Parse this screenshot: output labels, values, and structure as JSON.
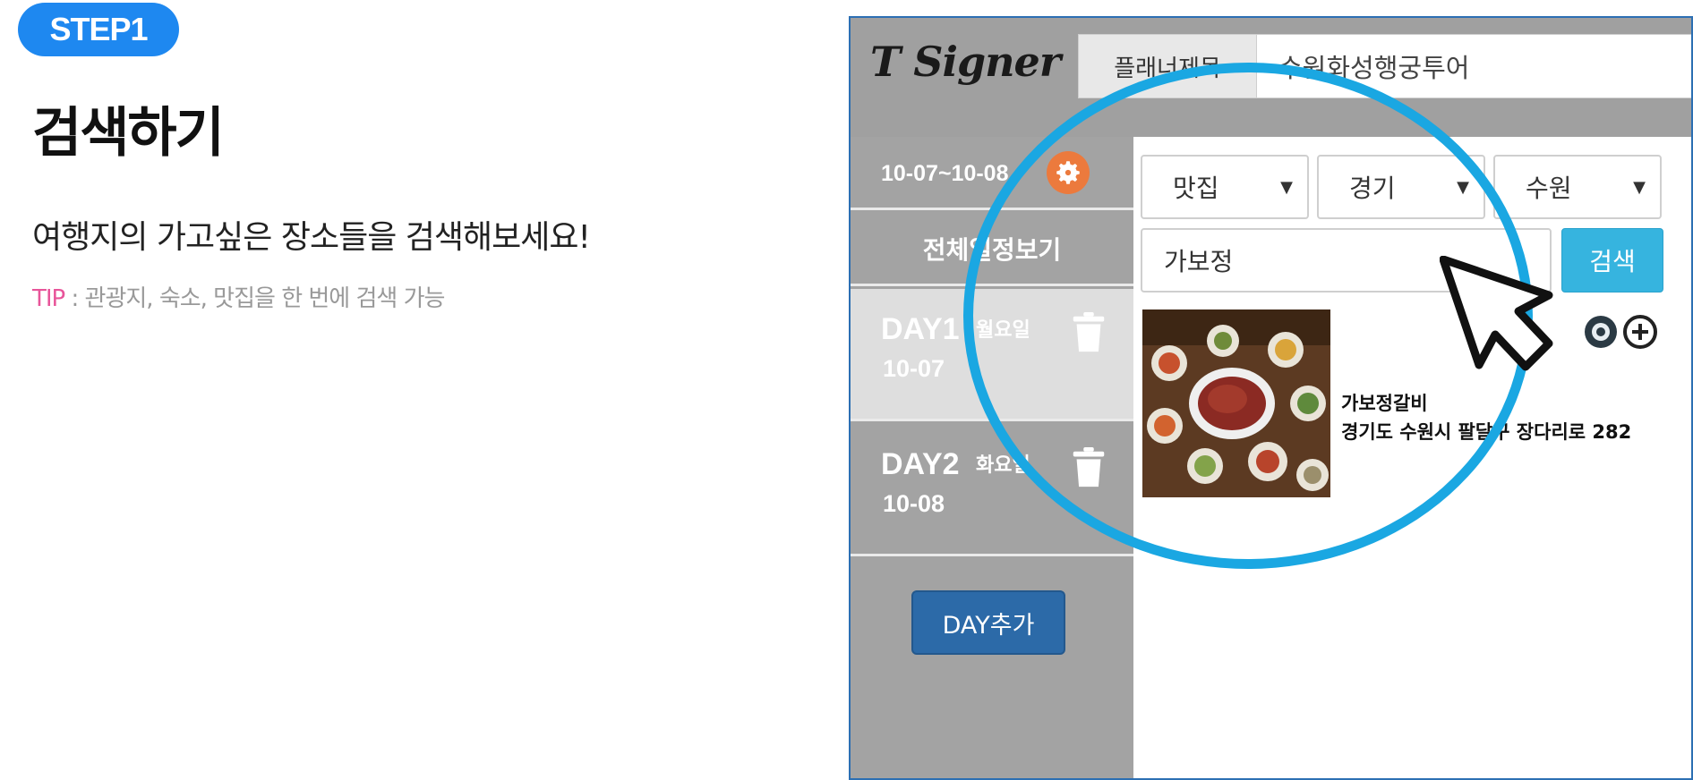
{
  "tutorial": {
    "step": "STEP1",
    "title": "검색하기",
    "description": "여행지의 가고싶은 장소들을 검색해보세요!",
    "tip_label": "TIP",
    "tip_text": " : 관광지, 숙소, 맛집을 한 번에 검색 가능"
  },
  "app": {
    "logo": "T Signer",
    "planner_title_label": "플래너제목",
    "planner_title_value": "수원화성행궁투어"
  },
  "sidebar": {
    "date_range": "10-07~10-08",
    "view_all_label": "전체일정보기",
    "days": [
      {
        "name": "DAY1",
        "weekday": "월요일",
        "date": "10-07"
      },
      {
        "name": "DAY2",
        "weekday": "화요일",
        "date": "10-08"
      }
    ],
    "add_day_label": "DAY추가"
  },
  "search": {
    "filters": [
      {
        "value": "맛집"
      },
      {
        "value": "경기"
      },
      {
        "value": "수원"
      }
    ],
    "query": "가보정",
    "button_label": "검색"
  },
  "result": {
    "name": "가보정갈비",
    "address": "경기도 수원시 팔달구 장다리로 282"
  },
  "colors": {
    "accent_blue": "#1aa7e2",
    "badge_blue": "#1e88f0",
    "gear_orange": "#ec7a3d",
    "tip_pink": "#e8559a"
  },
  "icons": [
    "gear-icon",
    "trash-icon",
    "view-icon",
    "add-circle-icon",
    "cursor-icon"
  ]
}
